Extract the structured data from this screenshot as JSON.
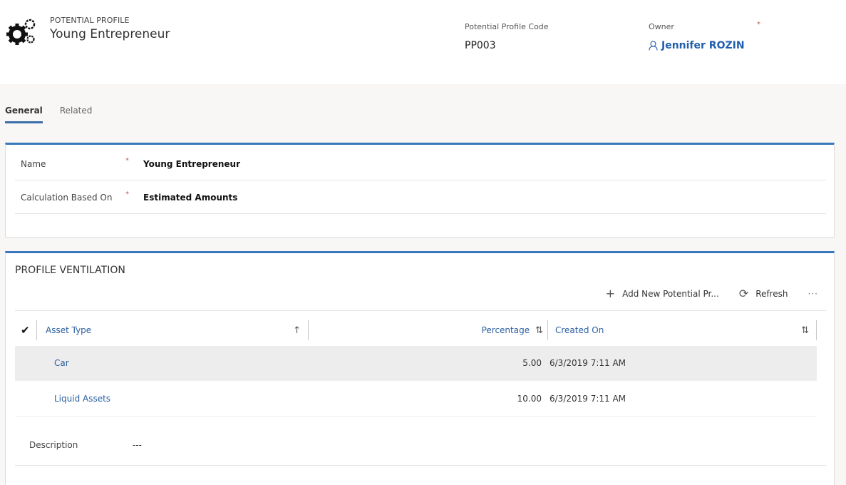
{
  "header": {
    "entity_type": "POTENTIAL PROFILE",
    "title": "Young Entrepreneur",
    "icon": "gears-icon",
    "code_label": "Potential Profile Code",
    "code_value": "PP003",
    "owner_label": "Owner",
    "owner_required": "*",
    "owner_value": "Jennifer ROZIN"
  },
  "tabs": [
    {
      "label": "General",
      "active": true
    },
    {
      "label": "Related",
      "active": false
    }
  ],
  "general": {
    "fields": [
      {
        "label": "Name",
        "required": "*",
        "value": "Young Entrepreneur"
      },
      {
        "label": "Calculation Based On",
        "required": "*",
        "value": "Estimated Amounts"
      }
    ]
  },
  "ventilation": {
    "title": "PROFILE VENTILATION",
    "commands": {
      "add_icon": "+",
      "add_label": "Add New Potential Pr...",
      "refresh_icon": "⟳",
      "refresh_label": "Refresh",
      "more": "···"
    },
    "columns": {
      "check": "✔",
      "asset_type": "Asset Type",
      "asset_sort": "↑",
      "percentage": "Percentage",
      "pct_sort": "⇅",
      "created_on": "Created On",
      "created_sort": "⇅"
    },
    "rows": [
      {
        "asset_type": "Car",
        "percentage": "5.00",
        "created_on": "6/3/2019 7:11 AM",
        "selected": true
      },
      {
        "asset_type": "Liquid Assets",
        "percentage": "10.00",
        "created_on": "6/3/2019 7:11 AM",
        "selected": false
      }
    ],
    "description_label": "Description",
    "description_value": "---"
  },
  "colors": {
    "accent": "#3a78bd",
    "link": "#2a5fa0",
    "required": "#b85c48"
  }
}
